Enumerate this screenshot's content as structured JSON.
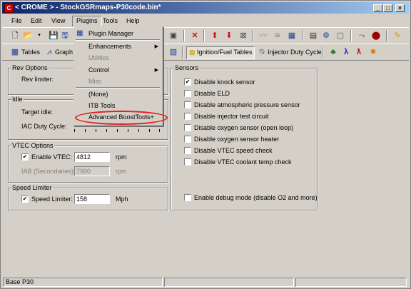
{
  "window": {
    "title": "< CROME > - StockGSRmaps-P30code.bin*",
    "minimize": "_",
    "maximize": "□",
    "close": "×"
  },
  "menubar": [
    "File",
    "Edit",
    "View",
    "Plugins",
    "Tools",
    "Help"
  ],
  "toolbar2": {
    "tables": "Tables",
    "graphs": "Graph",
    "ign_fuel": "Ignition/Fuel Tables",
    "injector": "Injector Duty Cycle"
  },
  "plugins_menu": {
    "items": [
      {
        "label": "Plugin Manager",
        "enabled": true,
        "submenu": false
      },
      {
        "label": "Enhancements",
        "enabled": true,
        "submenu": true
      },
      {
        "label": "Utilities",
        "enabled": false,
        "submenu": false
      },
      {
        "label": "Control",
        "enabled": true,
        "submenu": true
      },
      {
        "label": "Misc",
        "enabled": false,
        "submenu": false
      },
      {
        "label": "(None)",
        "enabled": true,
        "submenu": false
      },
      {
        "label": "ITB Tools",
        "enabled": true,
        "submenu": false
      },
      {
        "label": "Advanced BoostTools+",
        "enabled": true,
        "submenu": false
      }
    ]
  },
  "rev_options": {
    "title": "Rev Options",
    "rev_limiter": "Rev limiter:"
  },
  "idle": {
    "title": "Idle",
    "target_idle": "Target idle:",
    "iac_duty": "IAC Duty Cycle:"
  },
  "vtec": {
    "title": "VTEC Options",
    "enable_label": "Enable VTEC:",
    "enable_checked": true,
    "enable_value": "4812",
    "enable_unit": "rpm",
    "iab_label": "IAB (Secondaries):",
    "iab_value": "7900",
    "iab_unit": "rpm"
  },
  "speed": {
    "title": "Speed Limiter",
    "label": "Speed Limiter:",
    "checked": true,
    "value": "158",
    "unit": "Mph"
  },
  "sensors": {
    "title": "Sensors",
    "items": [
      {
        "label": "Disable knock sensor",
        "checked": true
      },
      {
        "label": "Disable ELD",
        "checked": false
      },
      {
        "label": "Disable atmospheric pressure sensor",
        "checked": false
      },
      {
        "label": "Disable injector test circuit",
        "checked": false
      },
      {
        "label": "Disable oxygen sensor (open loop)",
        "checked": false
      },
      {
        "label": "Disable oxygen sensor heater",
        "checked": false
      },
      {
        "label": "Disable VTEC speed check",
        "checked": false
      },
      {
        "label": "Disable VTEC coolant temp check",
        "checked": false
      }
    ],
    "debug": {
      "label": "Enable debug mode (disable O2 and more)",
      "checked": false
    }
  },
  "status": {
    "left": "Base P30"
  },
  "colors": {
    "highlight": "#0a246a",
    "annotation": "#e02020"
  }
}
